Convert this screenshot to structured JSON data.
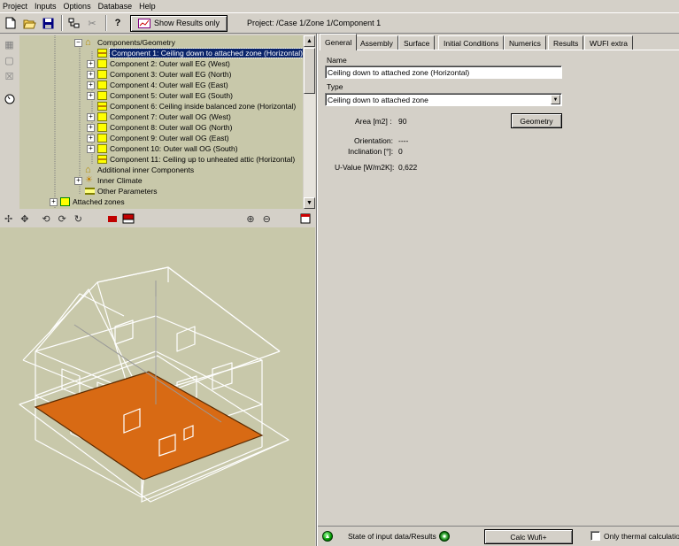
{
  "menu": [
    "Project",
    "Inputs",
    "Options",
    "Database",
    "Help"
  ],
  "toolbar": {
    "show_results_label": "Show Results only",
    "project_path": "Project: /Case 1/Zone 1/Component 1"
  },
  "tree": {
    "root": "Components/Geometry",
    "components": [
      {
        "label": "Component 1: Ceiling down to attached zone (Horizontal)",
        "icon": "ceiling",
        "expander": "",
        "selected": true
      },
      {
        "label": "Component 2: Outer wall EG (West)",
        "icon": "wall",
        "expander": "+"
      },
      {
        "label": "Component 3: Outer wall EG (North)",
        "icon": "wall",
        "expander": "+"
      },
      {
        "label": "Component 4: Outer wall EG (East)",
        "icon": "wall",
        "expander": "+"
      },
      {
        "label": "Component 5: Outer wall EG (South)",
        "icon": "wall",
        "expander": "+"
      },
      {
        "label": "Component 6: Ceiling inside balanced zone (Horizontal)",
        "icon": "ceiling",
        "expander": ""
      },
      {
        "label": "Component 7: Outer wall OG (West)",
        "icon": "wall",
        "expander": "+"
      },
      {
        "label": "Component 8: Outer wall OG (North)",
        "icon": "wall",
        "expander": "+"
      },
      {
        "label": "Component 9: Outer wall OG (East)",
        "icon": "wall",
        "expander": "+"
      },
      {
        "label": "Component 10: Outer wall OG (South)",
        "icon": "wall",
        "expander": "+"
      },
      {
        "label": "Component 11: Ceiling up to unheated attic (Horizontal)",
        "icon": "ceiling",
        "expander": ""
      }
    ],
    "additional_inner": "Additional inner Components",
    "inner_climate": "Inner Climate",
    "other_parameters": "Other Parameters",
    "attached_zones": "Attached zones"
  },
  "tabs": [
    "General",
    "Assembly",
    "Surface",
    "Initial Conditions",
    "Numerics",
    "Results",
    "WUFI extra"
  ],
  "general": {
    "name_label": "Name",
    "name_value": "Ceiling down to attached zone (Horizontal)",
    "type_label": "Type",
    "type_value": "Ceiling down to attached zone",
    "area_label": "Area [m2] :",
    "area_value": "90",
    "geometry_button": "Geometry",
    "orientation_label": "Orientation:",
    "orientation_value": "----",
    "inclination_label": "Inclination [°]:",
    "inclination_value": "0",
    "uvalue_label": "U-Value [W/m2K]:",
    "uvalue_value": "0,622"
  },
  "status": {
    "state_label": "State of input data/Results",
    "calc_button": "Calc Wufi+",
    "thermal_label": "Only thermal calculation"
  },
  "colors": {
    "panel_bg": "#c8c8aa",
    "floor_fill": "#d86a14",
    "wireframe": "#ffffff",
    "selection": "#0a246a"
  }
}
